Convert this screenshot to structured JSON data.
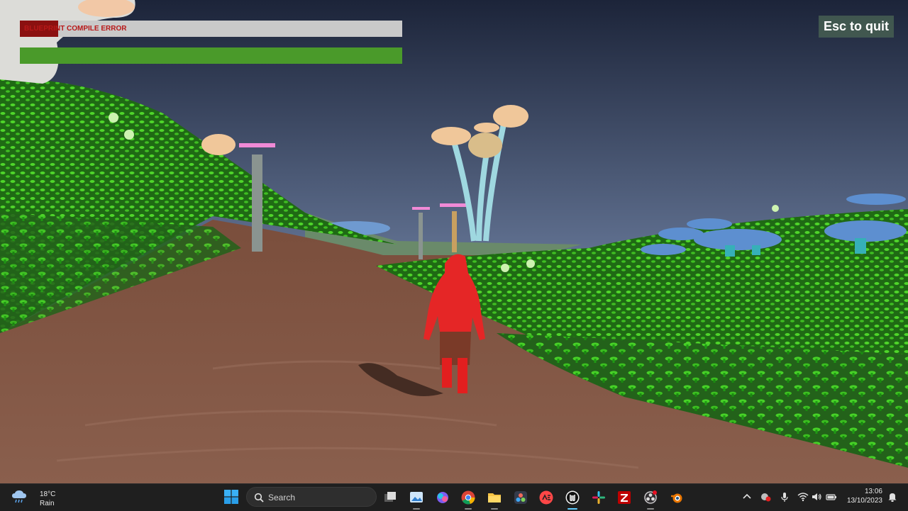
{
  "game": {
    "hud": {
      "health_bar": {
        "label": "BLUEPRINT COMPILE ERROR",
        "fill_fraction": 0.1
      },
      "stamina_bar": {
        "fill_fraction": 1.0
      }
    },
    "quit_hint": "Esc to quit"
  },
  "taskbar": {
    "weather": {
      "temperature": "18°C",
      "condition": "Rain",
      "icon": "rain-cloud-icon"
    },
    "search": {
      "placeholder": "Search"
    },
    "apps": [
      {
        "name": "task-view",
        "icon": "task-view-icon"
      },
      {
        "name": "photos",
        "icon": "photos-icon"
      },
      {
        "name": "copilot",
        "icon": "copilot-icon"
      },
      {
        "name": "chrome",
        "icon": "chrome-icon"
      },
      {
        "name": "file-explorer",
        "icon": "folder-icon"
      },
      {
        "name": "davinci-resolve",
        "icon": "davinci-icon"
      },
      {
        "name": "ea-app",
        "icon": "ea-icon"
      },
      {
        "name": "unreal-engine",
        "icon": "unreal-icon"
      },
      {
        "name": "slack",
        "icon": "slack-icon"
      },
      {
        "name": "filezilla",
        "icon": "filezilla-icon"
      },
      {
        "name": "obs-studio",
        "icon": "obs-icon"
      },
      {
        "name": "blender",
        "icon": "blender-icon"
      }
    ],
    "tray": [
      "chevron-up-icon",
      "security-icon",
      "microphone-icon",
      "wifi-icon",
      "speaker-icon",
      "battery-icon"
    ],
    "clock": {
      "time": "13:06",
      "date": "13/10/2023"
    },
    "notification_icon": "bell-icon"
  },
  "colors": {
    "health_fill": "#8b1010",
    "health_text": "#b81818",
    "stamina": "#4a9a2a",
    "quit_badge": "#465e52"
  }
}
